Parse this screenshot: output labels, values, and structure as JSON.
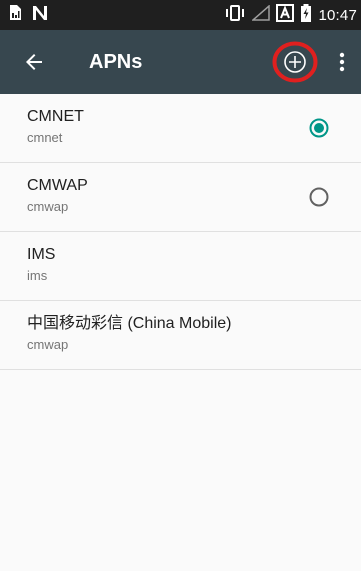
{
  "status_bar": {
    "time": "10:47",
    "icons": [
      "sim-card-icon",
      "n-notification-icon",
      "vibrate-icon",
      "signal-icon",
      "no-sim-icon",
      "battery-icon"
    ]
  },
  "toolbar": {
    "title": "APNs",
    "back_icon": "arrow-back-icon",
    "add_icon": "add-circle-icon",
    "more_icon": "more-vert-icon",
    "highlight_color": "#e0201f"
  },
  "colors": {
    "toolbar_bg": "#37474f",
    "status_bg": "#1f1f1f",
    "accent": "#009688"
  },
  "apns": [
    {
      "name": "CMNET",
      "apn": "cmnet",
      "selectable": true,
      "selected": true
    },
    {
      "name": "CMWAP",
      "apn": "cmwap",
      "selectable": true,
      "selected": false
    },
    {
      "name": "IMS",
      "apn": "ims",
      "selectable": false,
      "selected": false
    },
    {
      "name": "中国移动彩信 (China Mobile)",
      "apn": "cmwap",
      "selectable": false,
      "selected": false
    }
  ]
}
